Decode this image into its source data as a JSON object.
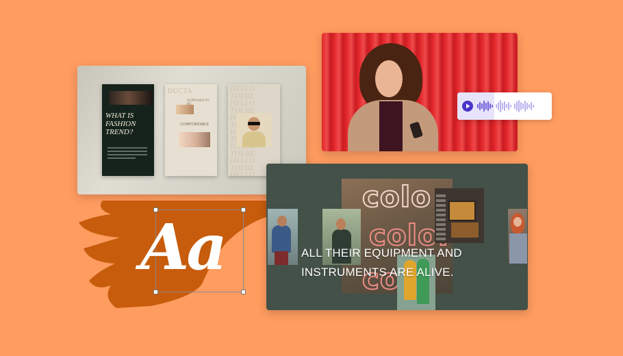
{
  "colors": {
    "background": "#ff9c60",
    "brush_stroke": "#c75c0c",
    "video_red": "#e1262b",
    "audio_accent": "#4a34c9",
    "color_card_bg": "#435148"
  },
  "fashion_templates": {
    "dark_story_title": "WHAT IS FASHION TREND?",
    "beige_story_heading": "DUCTA",
    "beige_story_subtitle": "SUPPOSED TO BE",
    "beige_story_caption": "COMFORTABLE",
    "hello_story_text": "HELLO THERE HELLO THERE HELLO THERE HELLO THERE HELLO THERE HELLO THERE HELLO THERE HELLO THERE HELLO THERE HELLO THERE HELLO THERE HELLO THERE"
  },
  "audio_player": {
    "play_icon": "play-icon",
    "waveform_icon": "waveform-icon"
  },
  "color_video": {
    "caption": "ALL THEIR EQUIPMENT AND INSTRUMENTS ARE ALIVE.",
    "neon_word_1": "colo",
    "neon_word_2": "color",
    "neon_word_3": "colo"
  },
  "text_demo": {
    "font_sample": "Aa"
  }
}
